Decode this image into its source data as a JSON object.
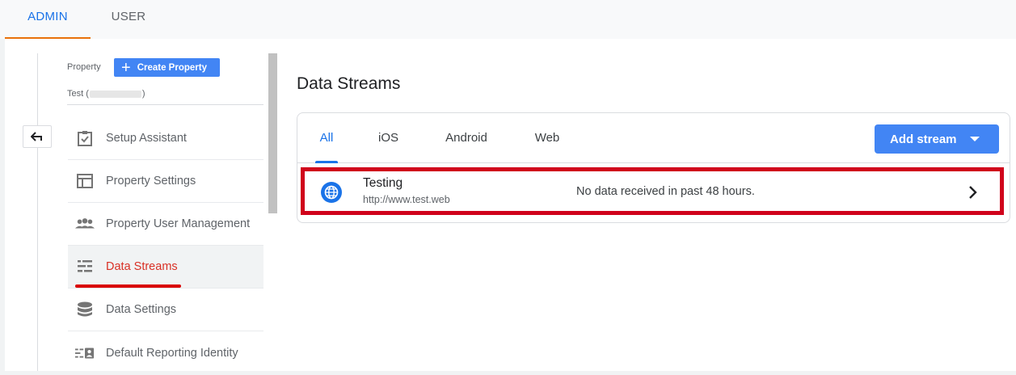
{
  "top_tabs": {
    "admin": "ADMIN",
    "user": "USER"
  },
  "property": {
    "label": "Property",
    "create_button": "Create Property",
    "name_prefix": "Test (",
    "name_suffix": ")"
  },
  "nav": {
    "items": [
      {
        "label": "Setup Assistant",
        "icon": "clipboard-check-icon"
      },
      {
        "label": "Property Settings",
        "icon": "layout-icon"
      },
      {
        "label": "Property User Management",
        "icon": "people-icon"
      },
      {
        "label": "Data Streams",
        "icon": "streams-icon",
        "active": true
      },
      {
        "label": "Data Settings",
        "icon": "database-icon"
      },
      {
        "label": "Default Reporting Identity",
        "icon": "identity-icon"
      }
    ]
  },
  "main": {
    "title": "Data Streams",
    "tabs": [
      "All",
      "iOS",
      "Android",
      "Web"
    ],
    "selected_tab": "All",
    "add_button": "Add stream",
    "stream": {
      "name": "Testing",
      "url": "http://www.test.web",
      "status": "No data received in past 48 hours."
    }
  },
  "colors": {
    "accent_blue": "#1a73e8",
    "button_blue": "#4285f4",
    "active_red": "#d93025",
    "highlight_red": "#d0021b",
    "tab_underline_orange": "#e8710a"
  }
}
